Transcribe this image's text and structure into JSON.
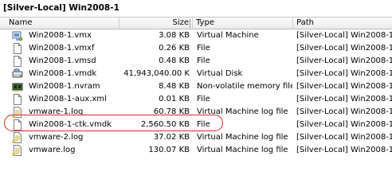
{
  "window": {
    "title": "[Silver-Local] Win2008-1"
  },
  "columns": {
    "name": "Name",
    "size": "Size",
    "type": "Type",
    "path": "Path"
  },
  "files": [
    {
      "name": "Win2008-1.vmx",
      "size": "3.08 KB",
      "type": "Virtual Machine",
      "path": "[Silver-Local] Win2008-1",
      "icon": "vm-config-icon"
    },
    {
      "name": "Win2008-1.vmxf",
      "size": "0.26 KB",
      "type": "File",
      "path": "[Silver-Local] Win2008-1",
      "icon": "file-icon"
    },
    {
      "name": "Win2008-1.vmsd",
      "size": "0.48 KB",
      "type": "File",
      "path": "[Silver-Local] Win2008-1",
      "icon": "file-icon"
    },
    {
      "name": "Win2008-1.vmdk",
      "size": "41,943,040.00 K",
      "type": "Virtual Disk",
      "path": "[Silver-Local] Win2008-1",
      "icon": "virtual-disk-icon"
    },
    {
      "name": "Win2008-1.nvram",
      "size": "8.48 KB",
      "type": "Non-volatile memory file",
      "path": "[Silver-Local] Win2008-1",
      "icon": "nvram-icon"
    },
    {
      "name": "Win2008-1-aux.xml",
      "size": "0.01 KB",
      "type": "File",
      "path": "[Silver-Local] Win2008-1",
      "icon": "file-icon"
    },
    {
      "name": "vmware-1.log",
      "size": "60.78 KB",
      "type": "Virtual Machine log file",
      "path": "[Silver-Local] Win2008-1",
      "icon": "log-file-icon"
    },
    {
      "name": "Win2008-1-ctk.vmdk",
      "size": "2,560.50 KB",
      "type": "File",
      "path": "[Silver-Local] Win2008-1",
      "icon": "file-icon"
    },
    {
      "name": "vmware-2.log",
      "size": "37.02 KB",
      "type": "Virtual Machine log file",
      "path": "[Silver-Local] Win2008-1",
      "icon": "log-file-icon"
    },
    {
      "name": "vmware.log",
      "size": "130.07 KB",
      "type": "Virtual Machine log file",
      "path": "[Silver-Local] Win2008-1",
      "icon": "log-file-icon"
    }
  ],
  "annotation": {
    "color": "#d42a2a",
    "highlighted_row": "Win2008-1-ctk.vmdk"
  }
}
